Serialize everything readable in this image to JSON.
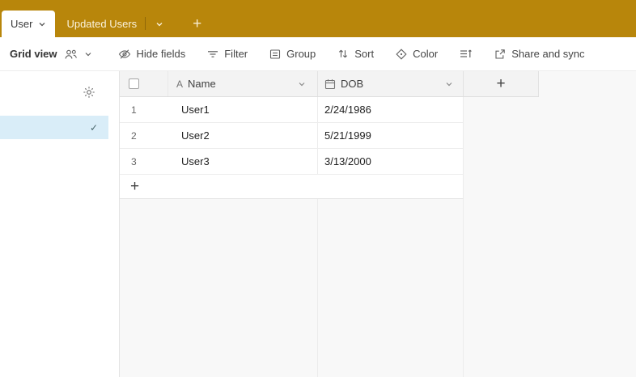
{
  "colors": {
    "topbar_bg": "#B8860B",
    "selected_view_bg": "#D9EDF8",
    "active_tab_bg": "#FFFFFF"
  },
  "topbar": {
    "active_tab": "User",
    "second_tab": "Updated Users"
  },
  "glyphs": {
    "plus": "+",
    "check": "✓",
    "field_text": "A"
  },
  "toolbar": {
    "view_name": "Grid view",
    "hide_fields": "Hide fields",
    "filter": "Filter",
    "group": "Group",
    "sort": "Sort",
    "color": "Color",
    "share_and_sync": "Share and sync"
  },
  "grid": {
    "columns": [
      {
        "label": "Name",
        "type": "text"
      },
      {
        "label": "DOB",
        "type": "date"
      }
    ],
    "rows": [
      {
        "num": "1",
        "name": "User1",
        "dob": "2/24/1986"
      },
      {
        "num": "2",
        "name": "User2",
        "dob": "5/21/1999"
      },
      {
        "num": "3",
        "name": "User3",
        "dob": "3/13/2000"
      }
    ]
  }
}
